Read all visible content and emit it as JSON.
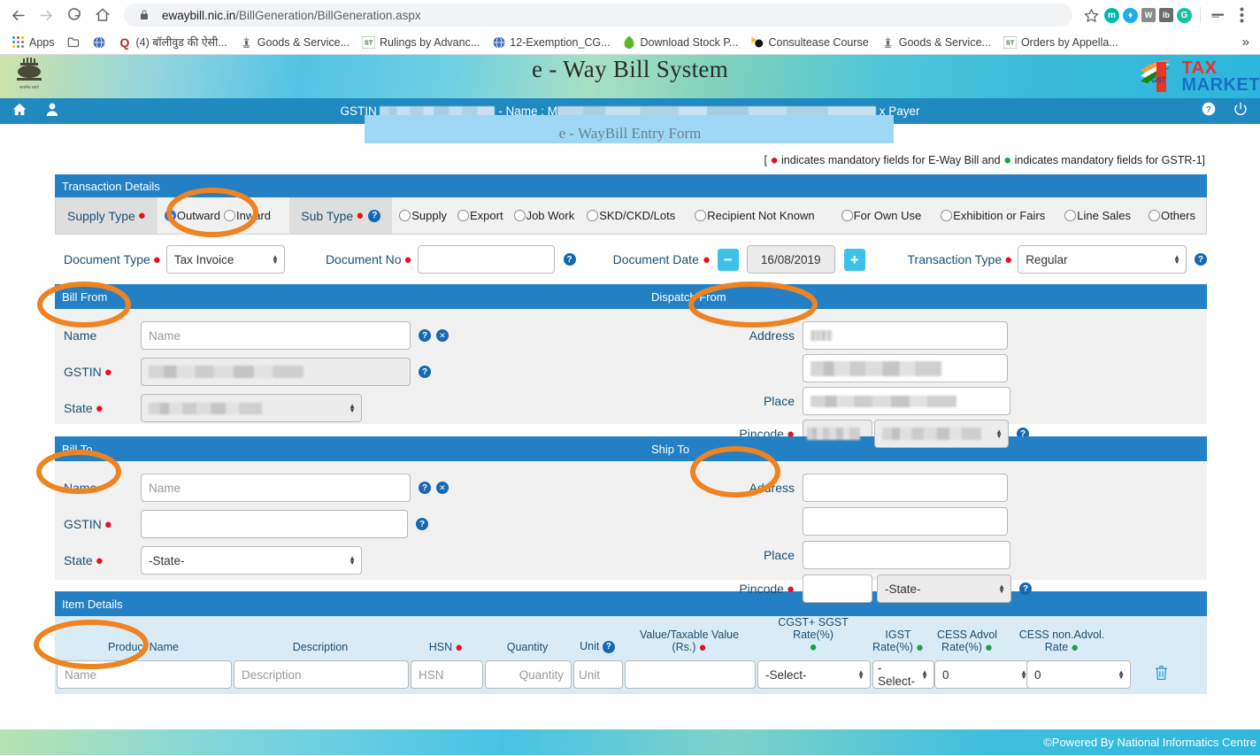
{
  "browser": {
    "url_domain": "ewaybill.nic.in",
    "url_path": "/BillGeneration/BillGeneration.aspx",
    "back_icon": "back-arrow-icon",
    "forward_icon": "forward-arrow-icon",
    "reload_icon": "reload-icon",
    "home_icon": "home-icon",
    "lock_icon": "lock-icon",
    "star_icon": "star-icon",
    "menu_icon": "three-dot-menu-icon",
    "minimize_icon": "minimize-icon",
    "extensions": [
      {
        "name": "m-extension",
        "letter": "m",
        "color": "#00b8a9",
        "shape": "circle"
      },
      {
        "name": "evernote-extension",
        "letter": "♦",
        "color": "#1eb0e8",
        "shape": "circle"
      },
      {
        "name": "wu-extension",
        "letter": "WJ",
        "color": "#707070",
        "shape": "square"
      },
      {
        "name": "ib-extension",
        "letter": "Ib",
        "color": "#6b6b6b",
        "shape": "square"
      },
      {
        "name": "grammarly-extension",
        "letter": "G",
        "color": "#15c39a",
        "shape": "circle"
      }
    ],
    "bookmarks": [
      {
        "label": "Apps",
        "icon": "apps-grid-icon"
      },
      {
        "label": "",
        "icon": "folder-icon"
      },
      {
        "label": "",
        "icon": "globe-icon"
      },
      {
        "label": "(4) बॉलीवुड की ऐसी...",
        "icon": "quora-icon"
      },
      {
        "label": "Goods & Service...",
        "icon": "emblem-icon"
      },
      {
        "label": "Rulings by Advanc...",
        "icon": "gst-icon"
      },
      {
        "label": "12-Exemption_CG...",
        "icon": "globe-icon"
      },
      {
        "label": "Download Stock P...",
        "icon": "leaf-icon"
      },
      {
        "label": "Consultease Course",
        "icon": "consultease-icon"
      },
      {
        "label": "Goods & Service...",
        "icon": "emblem-icon"
      },
      {
        "label": "Orders by Appella...",
        "icon": "gst-icon"
      }
    ],
    "overflow_label": "»"
  },
  "header": {
    "system_title": "e - Way Bill System",
    "emblem_motto": "सत्यमेव जयते",
    "logo_gst": "GST",
    "logo_line1": "TAX",
    "logo_line2": "MARKET",
    "nav": {
      "home_icon": "home-icon",
      "user_icon": "user-profile-icon",
      "gstin_label": "GSTIN",
      "gstin_value": "",
      "name_label": "- Name :",
      "name_value": "M",
      "role_suffix": "x Payer",
      "help_icon": "help-circle-icon",
      "logout_icon": "power-logout-icon"
    },
    "page_subtitle": "e - WayBill Entry Form",
    "mandatory_note_part1": "[",
    "mandatory_note_part2": "indicates mandatory fields for E-Way Bill and",
    "mandatory_note_part3": "indicates mandatory fields for GSTR-1]"
  },
  "transaction_details": {
    "section_title": "Transaction Details",
    "supply_type_label": "Supply Type",
    "supply_type_options": [
      {
        "label": "Outward",
        "selected": true
      },
      {
        "label": "Inward",
        "selected": false
      }
    ],
    "sub_type_label": "Sub Type",
    "sub_type_options": [
      {
        "label": "Supply",
        "selected": false
      },
      {
        "label": "Export",
        "selected": false
      },
      {
        "label": "Job Work",
        "selected": false
      },
      {
        "label": "SKD/CKD/Lots",
        "selected": false
      },
      {
        "label": "Recipient Not Known",
        "selected": false
      },
      {
        "label": "For Own Use",
        "selected": false
      },
      {
        "label": "Exhibition or Fairs",
        "selected": false
      },
      {
        "label": "Line Sales",
        "selected": false
      },
      {
        "label": "Others",
        "selected": false
      }
    ],
    "document_type_label": "Document Type",
    "document_type_value": "Tax Invoice",
    "document_no_label": "Document No",
    "document_no_value": "",
    "document_date_label": "Document Date",
    "document_date_value": "16/08/2019",
    "date_minus_label": "−",
    "date_plus_label": "+",
    "transaction_type_label": "Transaction Type",
    "transaction_type_value": "Regular"
  },
  "bill_from": {
    "section_title": "Bill From",
    "name_label": "Name",
    "name_placeholder": "Name",
    "name_value": "",
    "gstin_label": "GSTIN",
    "gstin_value": "",
    "state_label": "State",
    "state_value": ""
  },
  "dispatch_from": {
    "section_title": "Dispatch From",
    "address_label": "Address",
    "address_line1": "",
    "address_line2": "",
    "place_label": "Place",
    "place_value": "",
    "pincode_label": "Pincode",
    "pincode_value": "",
    "state_value": ""
  },
  "bill_to": {
    "section_title": "Bill To",
    "name_label": "Name",
    "name_placeholder": "Name",
    "name_value": "",
    "gstin_label": "GSTIN",
    "gstin_value": "",
    "state_label": "State",
    "state_value": "-State-"
  },
  "ship_to": {
    "section_title": "Ship To",
    "address_label": "Address",
    "address_line1": "",
    "address_line2": "",
    "place_label": "Place",
    "place_value": "",
    "pincode_label": "Pincode",
    "pincode_value": "",
    "state_value": "-State-"
  },
  "item_details": {
    "section_title": "Item Details",
    "columns": [
      {
        "label": "Product Name",
        "mandatory": "none"
      },
      {
        "label": "Description",
        "mandatory": "none"
      },
      {
        "label": "HSN",
        "mandatory": "red"
      },
      {
        "label": "Quantity",
        "mandatory": "none"
      },
      {
        "label": "Unit",
        "mandatory": "help"
      },
      {
        "label": "Value/Taxable Value (Rs.)",
        "mandatory": "red"
      },
      {
        "label": "CGST+ SGST Rate(%)",
        "mandatory": "green"
      },
      {
        "label": "IGST Rate(%)",
        "mandatory": "green"
      },
      {
        "label": "CESS Advol Rate(%)",
        "mandatory": "green"
      },
      {
        "label": "CESS non.Advol. Rate",
        "mandatory": "green"
      }
    ],
    "row": {
      "product_name_placeholder": "Name",
      "description_placeholder": "Description",
      "hsn_placeholder": "HSN",
      "quantity_placeholder": "Quantity",
      "unit_placeholder": "Unit",
      "value_taxable": "",
      "cgst_sgst_rate": "-Select-",
      "igst_rate": "-Select-",
      "cess_advol_rate": "0",
      "cess_nonadvol_rate": "0",
      "delete_icon": "trash-delete-icon"
    }
  },
  "footer": {
    "copyright": "©Powered By National Informatics Centre"
  },
  "annotations": {
    "color": "#ef8321",
    "circled": [
      "Outward",
      "Bill From",
      "Dispatch From",
      "Bill To",
      "Ship To",
      "Item Details"
    ]
  }
}
